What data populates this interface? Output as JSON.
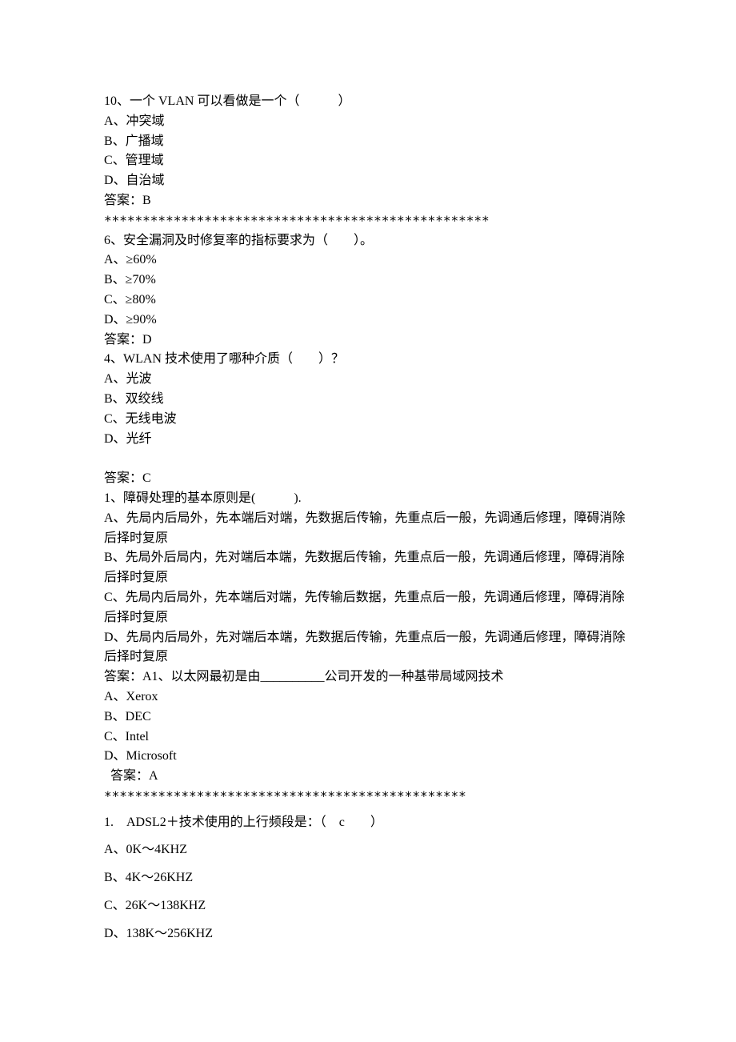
{
  "q10": {
    "stem": "10、一个 VLAN 可以看做是一个（　　　）",
    "optA": "A、冲突域",
    "optB": "B、广播域",
    "optC": "C、管理域",
    "optD": "D、自治域",
    "ans": "答案：B"
  },
  "sep1": "**************************************************",
  "q6": {
    "stem": "6、安全漏洞及时修复率的指标要求为（　　）。",
    "optA": "A、≥60%",
    "optB": "B、≥70%",
    "optC": "C、≥80%",
    "optD": "D、≥90%",
    "ans": "答案：D"
  },
  "q4": {
    "stem": "4、WLAN 技术使用了哪种介质（　　）？",
    "optA": "A、光波",
    "optB": "B、双绞线",
    "optC": "C、无线电波",
    "optD": "D、光纤",
    "ans": "答案：C"
  },
  "q1a": {
    "stem": "1、障碍处理的基本原则是(　　　).",
    "optA": "A、先局内后局外，先本端后对端，先数据后传输，先重点后一般，先调通后修理，障碍消除后择时复原",
    "optB": "B、先局外后局内，先对端后本端，先数据后传输，先重点后一般，先调通后修理，障碍消除后择时复原",
    "optC": "C、先局内后局外，先本端后对端，先传输后数据，先重点后一般，先调通后修理，障碍消除后择时复原",
    "optD": "D、先局内后局外，先对端后本端，先数据后传输，先重点后一般，先调通后修理，障碍消除后择时复原",
    "ans_plus_next": "答案：A1、以太网最初是由__________公司开发的一种基带局域网技术"
  },
  "q1b": {
    "optA": "A、Xerox",
    "optB": "B、DEC",
    "optC": "C、Intel",
    "optD": "D、Microsoft",
    "ans": "  答案：A"
  },
  "sep2": "***********************************************",
  "q1c": {
    "stem": "1.　ADSL2＋技术使用的上行频段是：（　c　　）",
    "optA": "A、0K～4KHZ",
    "optB": "B、4K～26KHZ",
    "optC": "C、26K～138KHZ",
    "optD": "D、138K～256KHZ"
  }
}
